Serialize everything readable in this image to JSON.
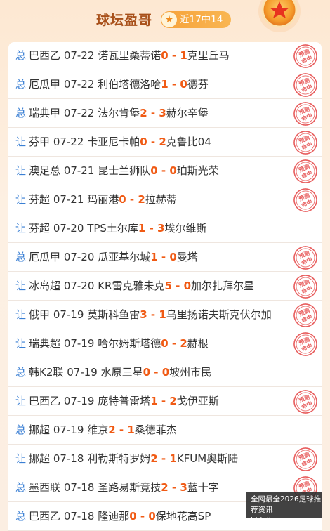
{
  "header": {
    "title": "球坛盈哥",
    "record": "近17中14",
    "icons": {
      "star": "star-icon",
      "medal": "medal-icon"
    }
  },
  "stamp_text": "预测命中",
  "colors": {
    "type": "#3a7fd4",
    "score": "#f05a14",
    "text": "#333333",
    "title": "#a8501a",
    "badge": "#f6a23a",
    "stamp": "#e85d5d"
  },
  "matches": [
    {
      "type": "总",
      "league": "巴西乙",
      "date": "07-22",
      "home": "诺瓦里桑蒂诺",
      "hs": "0",
      "as": "1",
      "away": "克里丘马",
      "hit": true
    },
    {
      "type": "总",
      "league": "厄瓜甲",
      "date": "07-22",
      "home": "利伯塔德洛哈",
      "hs": "1",
      "as": "0",
      "away": "德芬",
      "hit": true
    },
    {
      "type": "总",
      "league": "瑞典甲",
      "date": "07-22",
      "home": "法尔肯堡",
      "hs": "2",
      "as": "3",
      "away": "赫尔辛堡",
      "hit": true
    },
    {
      "type": "让",
      "league": "芬甲",
      "date": "07-22",
      "home": "卡亚尼卡帕",
      "hs": "0",
      "as": "2",
      "away": "克鲁比04",
      "hit": true
    },
    {
      "type": "让",
      "league": "澳足总",
      "date": "07-21",
      "home": "昆士兰狮队",
      "hs": "0",
      "as": "0",
      "away": "珀斯光荣",
      "hit": true
    },
    {
      "type": "让",
      "league": "芬超",
      "date": "07-21",
      "home": "玛丽港",
      "hs": "0",
      "as": "2",
      "away": "拉赫蒂",
      "hit": true
    },
    {
      "type": "让",
      "league": "芬超",
      "date": "07-20",
      "home": "TPS土尔库",
      "hs": "1",
      "as": "3",
      "away": "埃尔维斯",
      "hit": false
    },
    {
      "type": "总",
      "league": "厄瓜甲",
      "date": "07-20",
      "home": "瓜亚基尔城",
      "hs": "1",
      "as": "0",
      "away": "曼塔",
      "hit": true
    },
    {
      "type": "让",
      "league": "冰岛超",
      "date": "07-20",
      "home": "KR雷克雅未克",
      "hs": "5",
      "as": "0",
      "away": "加尔扎拜尔星",
      "hit": true
    },
    {
      "type": "让",
      "league": "俄甲",
      "date": "07-19",
      "home": "莫斯科鱼雷",
      "hs": "3",
      "as": "1",
      "away": "乌里扬诺夫斯克伏尔加",
      "hit": true
    },
    {
      "type": "让",
      "league": "瑞典超",
      "date": "07-19",
      "home": "哈尔姆斯塔德",
      "hs": "0",
      "as": "2",
      "away": "赫根",
      "hit": true
    },
    {
      "type": "总",
      "league": "韩K2联",
      "date": "07-19",
      "home": "水原三星",
      "hs": "0",
      "as": "0",
      "away": "坡州市民",
      "hit": false
    },
    {
      "type": "让",
      "league": "巴西乙",
      "date": "07-19",
      "home": "庞特普雷塔",
      "hs": "1",
      "as": "2",
      "away": "戈伊亚斯",
      "hit": true
    },
    {
      "type": "总",
      "league": "挪超",
      "date": "07-19",
      "home": "维京",
      "hs": "2",
      "as": "1",
      "away": "桑德菲杰",
      "hit": false
    },
    {
      "type": "让",
      "league": "挪超",
      "date": "07-18",
      "home": "利勒斯特罗姆",
      "hs": "2",
      "as": "1",
      "away": "KFUM奥斯陆",
      "hit": true
    },
    {
      "type": "总",
      "league": "墨西联",
      "date": "07-18",
      "home": "圣路易斯竞技",
      "hs": "2",
      "as": "3",
      "away": "蓝十字",
      "hit": true
    },
    {
      "type": "总",
      "league": "巴西乙",
      "date": "07-18",
      "home": "隆迪那",
      "hs": "0",
      "as": "0",
      "away": "保地花高SP",
      "hit": false
    }
  ],
  "watermark": {
    "line1": "全网最全2026足球推荐资讯",
    "line2": "bjdujiacun.com"
  }
}
